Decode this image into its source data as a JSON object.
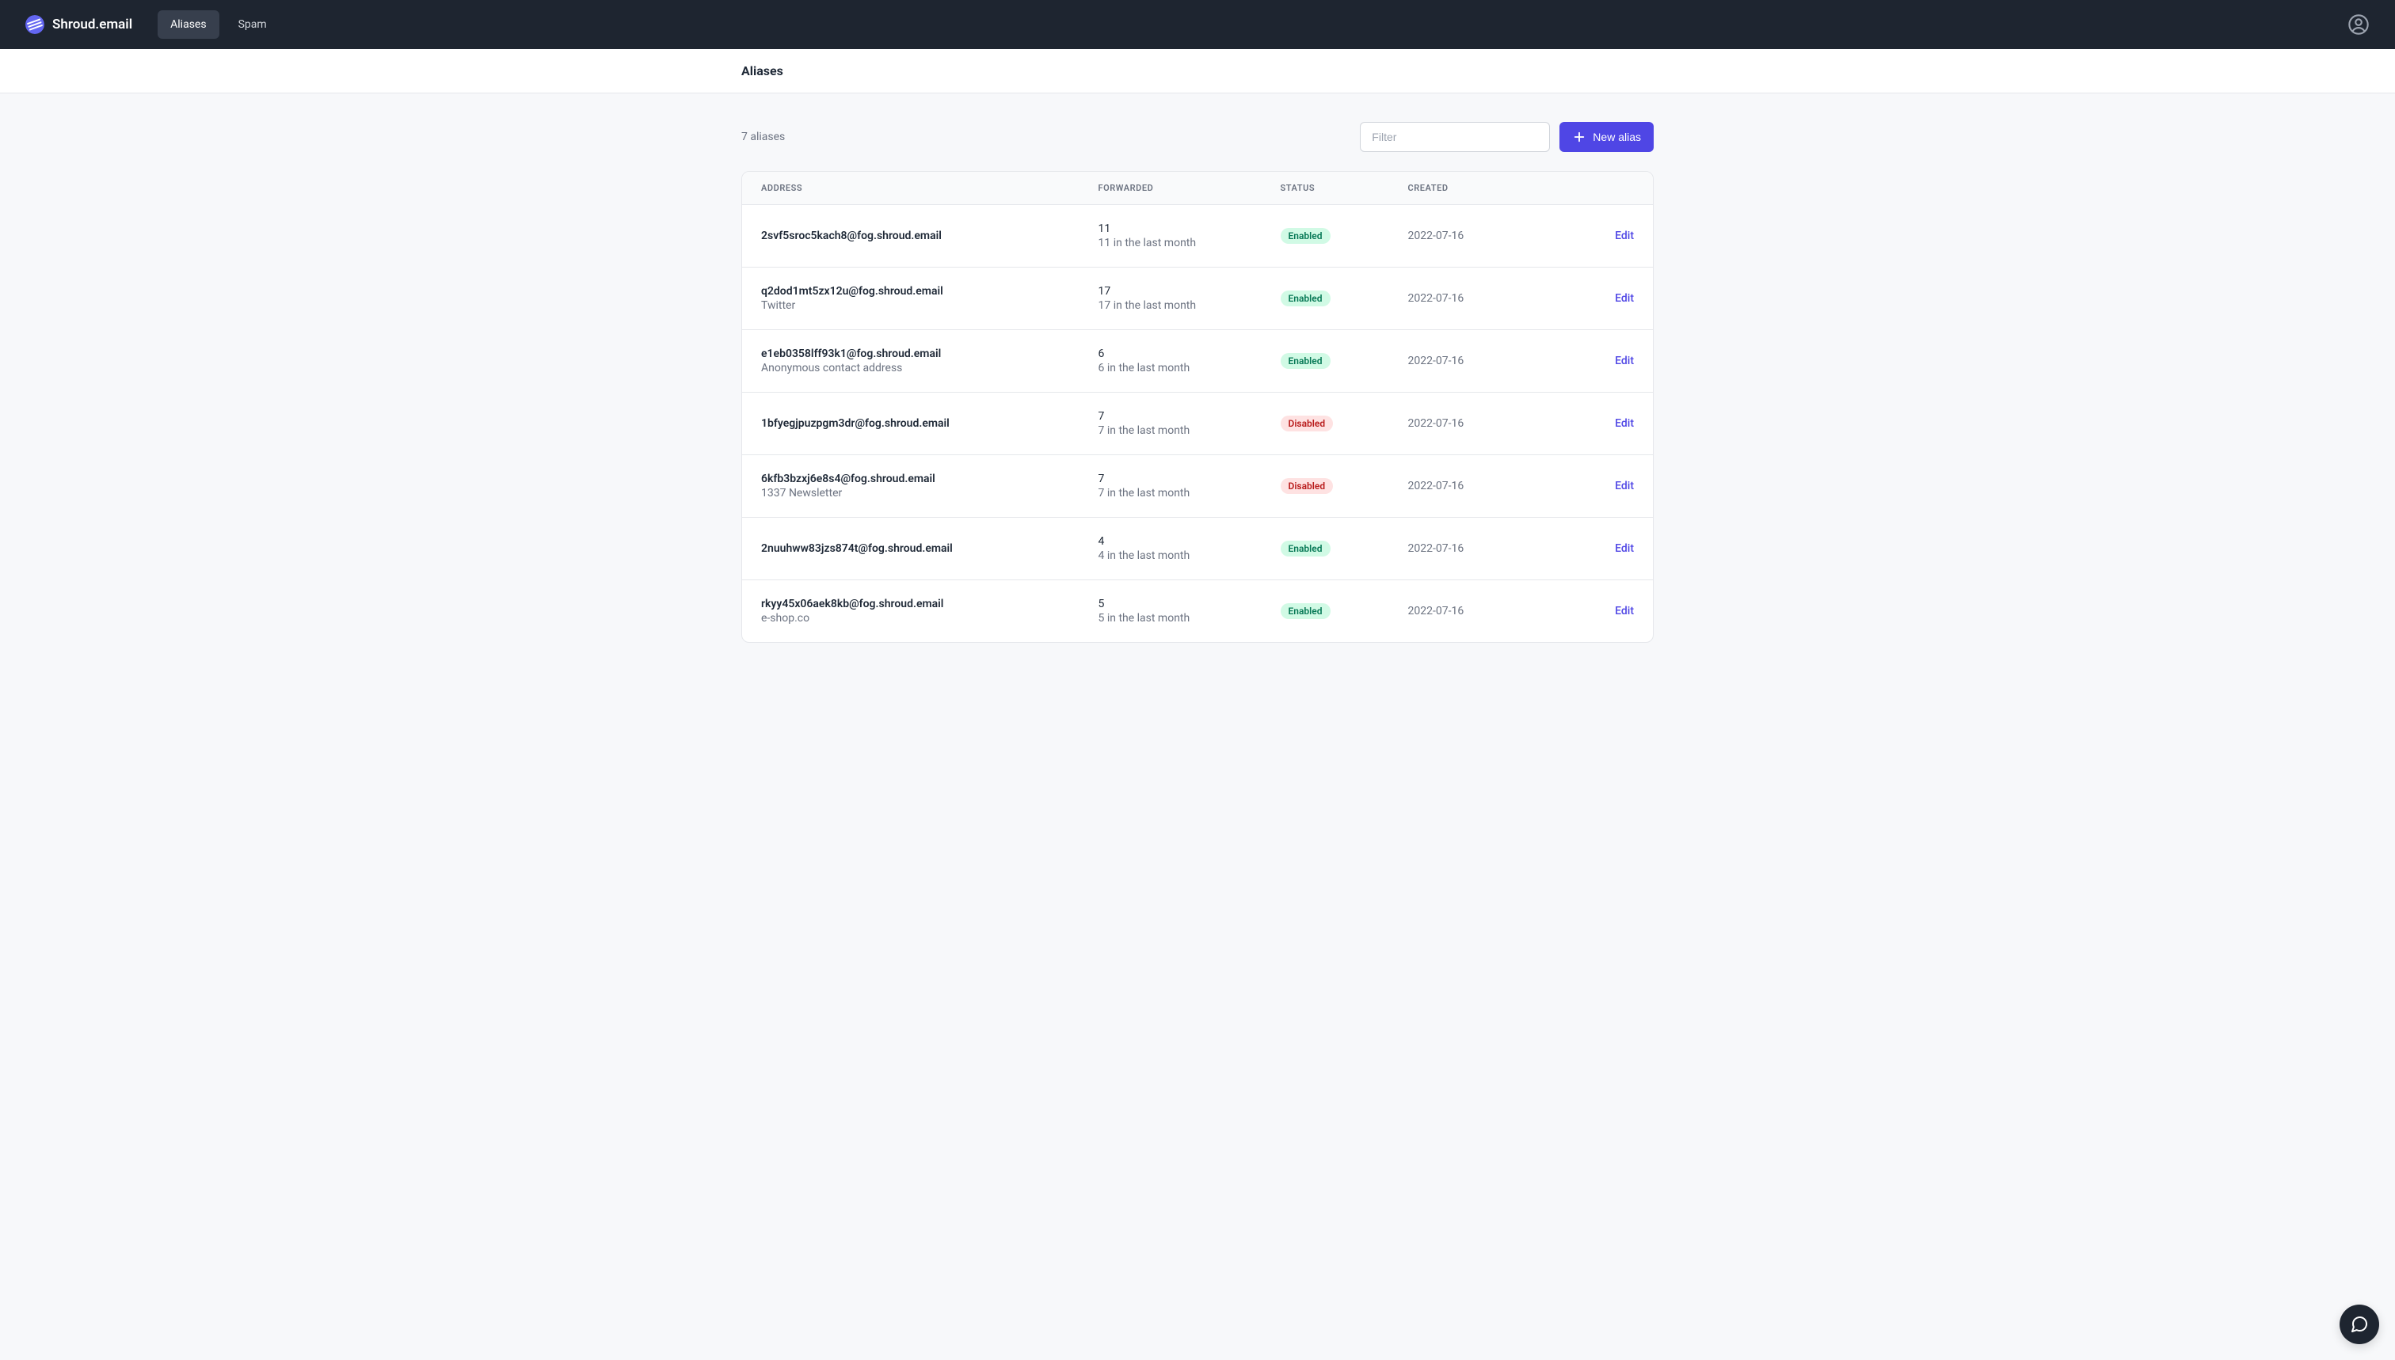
{
  "brand": {
    "name": "Shroud.email"
  },
  "nav": {
    "aliases": "Aliases",
    "spam": "Spam"
  },
  "page": {
    "title": "Aliases",
    "count_text": "7 aliases"
  },
  "toolbar": {
    "filter_placeholder": "Filter",
    "new_alias_label": "New alias"
  },
  "columns": {
    "address": "Address",
    "forwarded": "Forwarded",
    "status": "Status",
    "created": "Created"
  },
  "status_labels": {
    "enabled": "Enabled",
    "disabled": "Disabled"
  },
  "action_label": "Edit",
  "aliases": [
    {
      "address": "2svf5sroc5kach8@fog.shroud.email",
      "label": "",
      "forwarded_count": "11",
      "forwarded_sub": "11 in the last month",
      "status": "enabled",
      "created": "2022-07-16"
    },
    {
      "address": "q2dod1mt5zx12u@fog.shroud.email",
      "label": "Twitter",
      "forwarded_count": "17",
      "forwarded_sub": "17 in the last month",
      "status": "enabled",
      "created": "2022-07-16"
    },
    {
      "address": "e1eb0358lff93k1@fog.shroud.email",
      "label": "Anonymous contact address",
      "forwarded_count": "6",
      "forwarded_sub": "6 in the last month",
      "status": "enabled",
      "created": "2022-07-16"
    },
    {
      "address": "1bfyegjpuzpgm3dr@fog.shroud.email",
      "label": "",
      "forwarded_count": "7",
      "forwarded_sub": "7 in the last month",
      "status": "disabled",
      "created": "2022-07-16"
    },
    {
      "address": "6kfb3bzxj6e8s4@fog.shroud.email",
      "label": "1337 Newsletter",
      "forwarded_count": "7",
      "forwarded_sub": "7 in the last month",
      "status": "disabled",
      "created": "2022-07-16"
    },
    {
      "address": "2nuuhww83jzs874t@fog.shroud.email",
      "label": "",
      "forwarded_count": "4",
      "forwarded_sub": "4 in the last month",
      "status": "enabled",
      "created": "2022-07-16"
    },
    {
      "address": "rkyy45x06aek8kb@fog.shroud.email",
      "label": "e-shop.co",
      "forwarded_count": "5",
      "forwarded_sub": "5 in the last month",
      "status": "enabled",
      "created": "2022-07-16"
    }
  ]
}
